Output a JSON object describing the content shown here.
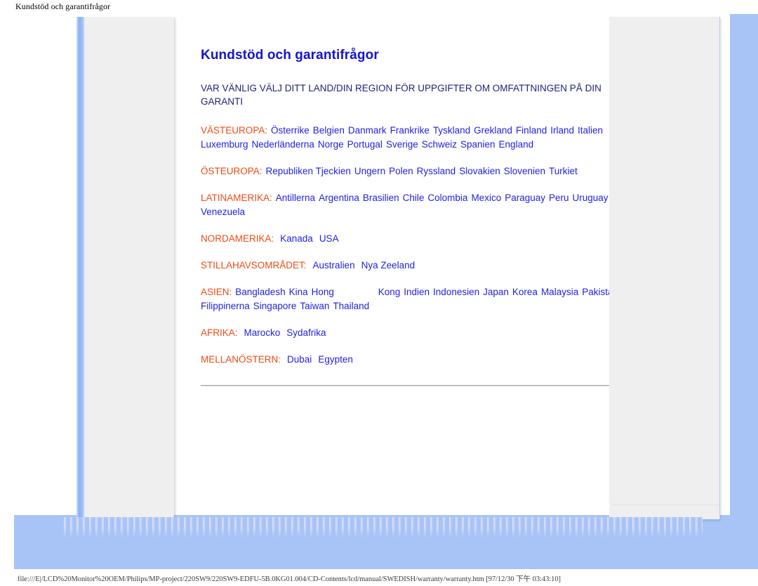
{
  "window": {
    "title": "Kundstöd och garantifrågor"
  },
  "status_bar": {
    "url": "file:///E|/LCD%20Monitor%20OEM/Philips/MP-project/220SW9/220SW9-EDFU-5B.0KG01.004/CD-Contents/lcd/manual/SWEDISH/warranty/warranty.htm [97/12/30 下午 03:43:10]"
  },
  "colors": {
    "heading": "#1414ce",
    "subtitle": "#1f1f7a",
    "region_label": "#f04a16",
    "link": "#1f1fe0",
    "page_background": "#a8c4f7",
    "panel_gray": "#efefef"
  },
  "document": {
    "title": "Kundstöd och garantifrågor",
    "subtitle": "VAR VÄNLIG VÄLJ DITT LAND/DIN REGION FÖR UPPGIFTER OM OMFATTNINGEN PÅ DIN GARANTI",
    "regions": [
      {
        "label": "VÄSTEUROPA:",
        "countries": [
          "Österrike",
          "Belgien",
          "Danmark",
          "Frankrike",
          "Tyskland",
          "Grekland",
          "Finland",
          "Irland",
          "Italien",
          "Luxemburg",
          "Nederländerna",
          "Norge",
          "Portugal",
          "Sverige",
          "Schweiz",
          "Spanien",
          "England"
        ]
      },
      {
        "label": "ÖSTEUROPA:",
        "countries": [
          "Republiken Tjeckien",
          "Ungern",
          "Polen",
          "Ryssland",
          "Slovakien",
          "Slovenien",
          "Turkiet"
        ]
      },
      {
        "label": "LATINAMERIKA:",
        "countries": [
          "Antillerna",
          "Argentina",
          "Brasilien",
          "Chile",
          "Colombia",
          "Mexico",
          "Paraguay",
          "Peru",
          "Uruguay",
          "Venezuela"
        ]
      },
      {
        "label": "NORDAMERIKA:",
        "countries": [
          "Kanada",
          "USA"
        ]
      },
      {
        "label": "STILLAHAVSOMRÅDET:",
        "countries": [
          "Australien",
          "Nya Zeeland"
        ]
      },
      {
        "label": "ASIEN:",
        "countries": [
          "Bangladesh",
          "Kina",
          "Hong Kong",
          "Indien",
          "Indonesien",
          "Japan",
          "Korea",
          "Malaysia",
          "Pakistan",
          "Filippinerna",
          "Singapore",
          "Taiwan",
          "Thailand"
        ]
      },
      {
        "label": "AFRIKA:",
        "countries": [
          "Marocko",
          "Sydafrika"
        ]
      },
      {
        "label": "MELLANÖSTERN:",
        "countries": [
          "Dubai",
          "Egypten"
        ]
      }
    ]
  }
}
